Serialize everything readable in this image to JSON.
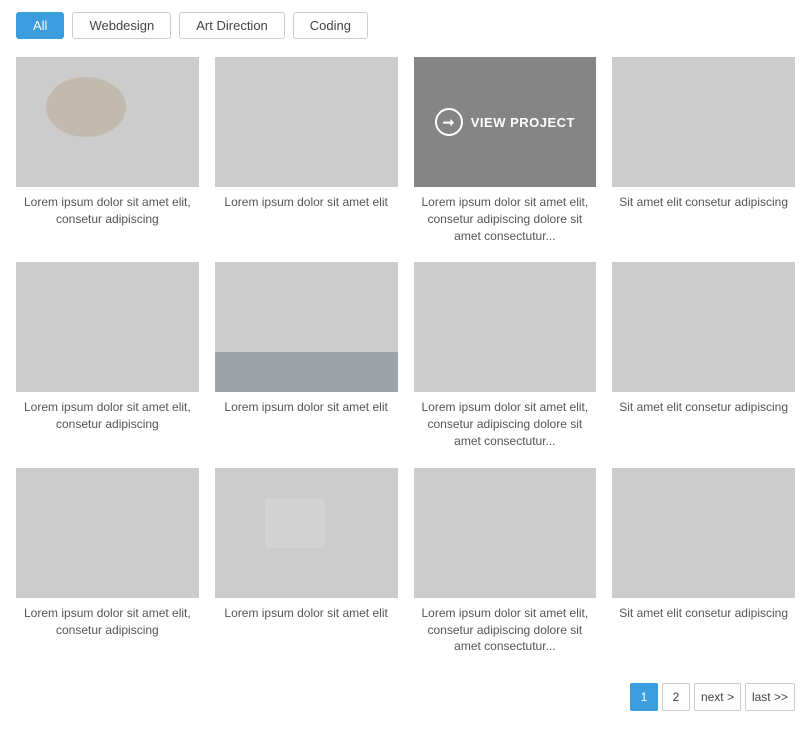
{
  "filters": {
    "buttons": [
      {
        "id": "all",
        "label": "All",
        "active": true
      },
      {
        "id": "webdesign",
        "label": "Webdesign",
        "active": false
      },
      {
        "id": "art-direction",
        "label": "Art Direction",
        "active": false
      },
      {
        "id": "coding",
        "label": "Coding",
        "active": false
      }
    ]
  },
  "gallery": {
    "items": [
      {
        "id": 1,
        "bgClass": "img-bg-1",
        "caption": "Lorem ipsum dolor sit amet elit, consetur adipiscing",
        "hasOverlay": false
      },
      {
        "id": 2,
        "bgClass": "img-bg-2",
        "caption": "Lorem ipsum dolor sit amet elit",
        "hasOverlay": false
      },
      {
        "id": 3,
        "bgClass": "img-bg-3",
        "caption": "Lorem ipsum dolor sit amet elit, consetur adipiscing dolore sit amet consectutur...",
        "hasOverlay": true
      },
      {
        "id": 4,
        "bgClass": "img-bg-4",
        "caption": "Sit amet elit consetur adipiscing",
        "hasOverlay": false
      },
      {
        "id": 5,
        "bgClass": "img-bg-5",
        "caption": "Lorem ipsum dolor sit amet elit, consetur adipiscing",
        "hasOverlay": false
      },
      {
        "id": 6,
        "bgClass": "img-bg-6",
        "caption": "Lorem ipsum dolor sit amet elit",
        "hasOverlay": false
      },
      {
        "id": 7,
        "bgClass": "img-bg-7",
        "caption": "Lorem ipsum dolor sit amet elit, consetur adipiscing dolore sit amet consectutur...",
        "hasOverlay": false
      },
      {
        "id": 8,
        "bgClass": "img-bg-8",
        "caption": "Sit amet elit consetur adipiscing",
        "hasOverlay": false
      },
      {
        "id": 9,
        "bgClass": "img-bg-9",
        "caption": "Lorem ipsum dolor sit amet elit, consetur adipiscing",
        "hasOverlay": false
      },
      {
        "id": 10,
        "bgClass": "img-bg-10",
        "caption": "Lorem ipsum dolor sit amet elit",
        "hasOverlay": false
      },
      {
        "id": 11,
        "bgClass": "img-bg-11",
        "caption": "Lorem ipsum dolor sit amet elit, consetur adipiscing dolore sit amet consectutur...",
        "hasOverlay": false
      },
      {
        "id": 12,
        "bgClass": "img-bg-12",
        "caption": "Sit amet elit consetur adipiscing",
        "hasOverlay": false
      }
    ],
    "viewProjectLabel": "VIEW PROJECT"
  },
  "pagination": {
    "pages": [
      "1",
      "2"
    ],
    "next": "next >",
    "last": "last >>",
    "activePage": "1"
  }
}
